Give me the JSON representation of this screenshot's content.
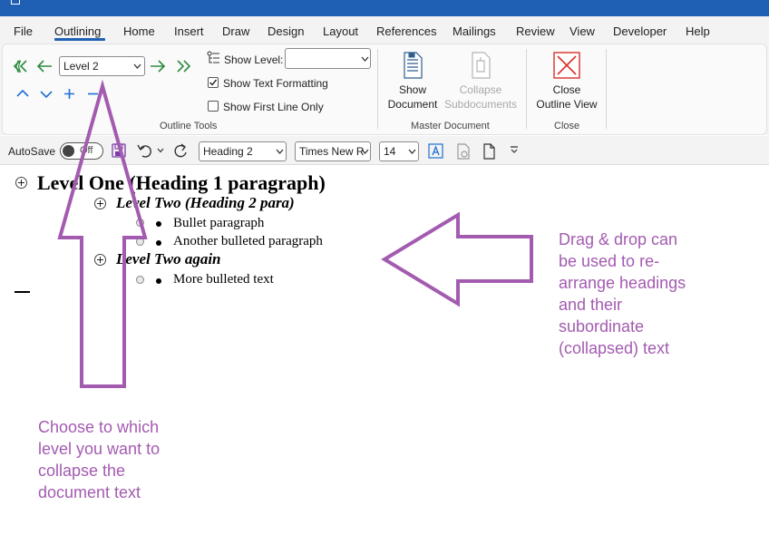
{
  "menu": {
    "items": [
      "File",
      "Outlining",
      "Home",
      "Insert",
      "Draw",
      "Design",
      "Layout",
      "References",
      "Mailings",
      "Review",
      "View",
      "Developer",
      "Help"
    ],
    "active": "Outlining"
  },
  "outline_tools": {
    "level_value": "Level 2",
    "show_level_label": "Show Level:",
    "show_level_value": "",
    "show_text_formatting_label": "Show Text Formatting",
    "show_text_formatting_checked": true,
    "show_first_line_only_label": "Show First Line Only",
    "show_first_line_only_checked": false,
    "group_label": "Outline Tools"
  },
  "master_document": {
    "show_document_line1": "Show",
    "show_document_line2": "Document",
    "collapse_line1": "Collapse",
    "collapse_line2": "Subdocuments",
    "group_label": "Master Document"
  },
  "close_group": {
    "close_line1": "Close",
    "close_line2": "Outline View",
    "group_label": "Close"
  },
  "qat": {
    "autosave_label": "AutoSave",
    "autosave_state": "Off",
    "style_value": "Heading 2",
    "font_value": "Times New R",
    "size_value": "14"
  },
  "document": {
    "lines": [
      {
        "level": 1,
        "text": "Level One (Heading 1 paragraph)"
      },
      {
        "level": 2,
        "text": "Level Two (Heading 2 para)"
      },
      {
        "level": "body",
        "text": "Bullet paragraph"
      },
      {
        "level": "body",
        "text": "Another bulleted paragraph"
      },
      {
        "level": 2,
        "text": "Level Two again"
      },
      {
        "level": "body",
        "text": "More bulleted text"
      }
    ]
  },
  "annotations": {
    "right_lines": [
      "Drag & drop can",
      "be used to re-",
      "arrange headings",
      "and their",
      "subordinate",
      "(collapsed) text"
    ],
    "left_lines": [
      "Choose to which",
      "level you want to",
      "collapse the",
      "document text"
    ],
    "color": "#a35bb0"
  },
  "colors": {
    "accent": "#1f5fb4",
    "green_arrow": "#2e8b3e",
    "blue_control": "#1f6fd1",
    "close_red": "#d9312b"
  }
}
